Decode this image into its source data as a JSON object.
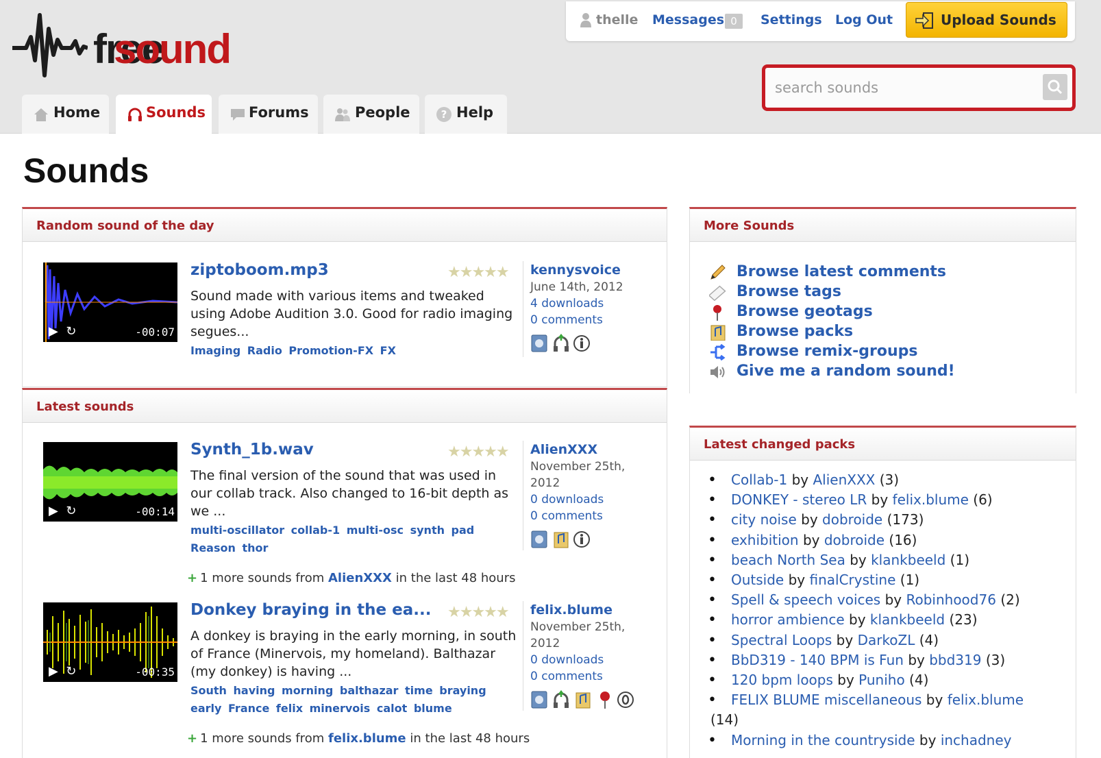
{
  "header": {
    "logo": {
      "part1": "free",
      "part2": "sound"
    },
    "user": {
      "name": "thelle"
    },
    "nav_links": {
      "messages": "Messages",
      "messages_count": "0",
      "settings": "Settings",
      "logout": "Log Out"
    },
    "upload_button": "Upload Sounds",
    "search": {
      "placeholder": "search sounds"
    },
    "tabs": [
      {
        "label": "Home"
      },
      {
        "label": "Sounds"
      },
      {
        "label": "Forums"
      },
      {
        "label": "People"
      },
      {
        "label": "Help"
      }
    ],
    "active_tab": "Sounds"
  },
  "page_title": "Sounds",
  "random_sound": {
    "section_title": "Random sound of the day",
    "name": "ziptoboom.mp3",
    "description": "Sound made with various items and tweaked using Adobe Audition 3.0. Good for radio imaging segues...",
    "tags": "Imaging Radio Promotion-FX FX",
    "user": "kennysvoice",
    "date": "June 14th, 2012",
    "downloads": "4 downloads",
    "comments": "0 comments",
    "duration": "-00:07",
    "rating": "★★★★★"
  },
  "latest_sounds": {
    "section_title": "Latest sounds",
    "items": [
      {
        "name": "Synth_1b.wav",
        "description": "The final version of the sound that was used in our collab track. Also changed to 16-bit depth as we ...",
        "tags": "multi-oscillator collab-1 multi-osc synth pad Reason thor",
        "user": "AlienXXX",
        "date": "November 25th, 2012",
        "downloads": "0 downloads",
        "comments": "0 comments",
        "duration": "-00:14",
        "rating": "★★★★★",
        "more": {
          "prefix": "1 more sounds from",
          "who": "AlienXXX",
          "suffix": "in the last 48 hours"
        }
      },
      {
        "name": "Donkey braying in the ea...",
        "description": "A donkey is braying in the early morning, in south of France (Minervois, my homeland). Balthazar (my donkey) is having ...",
        "tags": "South having morning balthazar time braying early France felix minervois calot blume",
        "user": "felix.blume",
        "date": "November 25th, 2012",
        "downloads": "0 downloads",
        "comments": "0 comments",
        "duration": "-00:35",
        "rating": "★★★★★",
        "more": {
          "prefix": "1 more sounds from",
          "who": "felix.blume",
          "suffix": "in the last 48 hours"
        }
      }
    ]
  },
  "more_sounds": {
    "section_title": "More Sounds",
    "items": [
      {
        "label": "Browse latest comments",
        "icon": "pencil-icon"
      },
      {
        "label": "Browse tags",
        "icon": "tag-icon"
      },
      {
        "label": "Browse geotags",
        "icon": "map-pin-icon"
      },
      {
        "label": "Browse packs",
        "icon": "pack-icon"
      },
      {
        "label": "Browse remix-groups",
        "icon": "remix-icon"
      },
      {
        "label": "Give me a random sound!",
        "icon": "speaker-icon"
      }
    ]
  },
  "packs": {
    "section_title": "Latest changed packs",
    "by": "by",
    "items": [
      {
        "name": "Collab-1",
        "user": "AlienXXX",
        "count": "(3)"
      },
      {
        "name": "DONKEY - stereo LR",
        "user": "felix.blume",
        "count": "(6)"
      },
      {
        "name": "city noise",
        "user": "dobroide",
        "count": "(173)"
      },
      {
        "name": "exhibition",
        "user": "dobroide",
        "count": "(16)"
      },
      {
        "name": "beach North Sea",
        "user": "klankbeeld",
        "count": "(1)"
      },
      {
        "name": "Outside",
        "user": "finalCrystine",
        "count": "(1)"
      },
      {
        "name": "Spell & speech voices",
        "user": "Robinhood76",
        "count": "(2)"
      },
      {
        "name": "horror ambience",
        "user": "klankbeeld",
        "count": "(23)"
      },
      {
        "name": "Spectral Loops",
        "user": "DarkoZL",
        "count": "(4)"
      },
      {
        "name": "BbD319 - 140 BPM is Fun",
        "user": "bbd319",
        "count": "(3)"
      },
      {
        "name": "120 bpm loops",
        "user": "Puniho",
        "count": "(4)"
      },
      {
        "name": "FELIX BLUME miscellaneous",
        "user": "felix.blume",
        "count": "(14)"
      },
      {
        "name": "Morning in the countryside",
        "user": "inchadney",
        "count": ""
      }
    ]
  },
  "colors": {
    "brand_red": "#c0181b",
    "link_blue": "#2a5db0",
    "upload_yellow": "#f3b400"
  }
}
